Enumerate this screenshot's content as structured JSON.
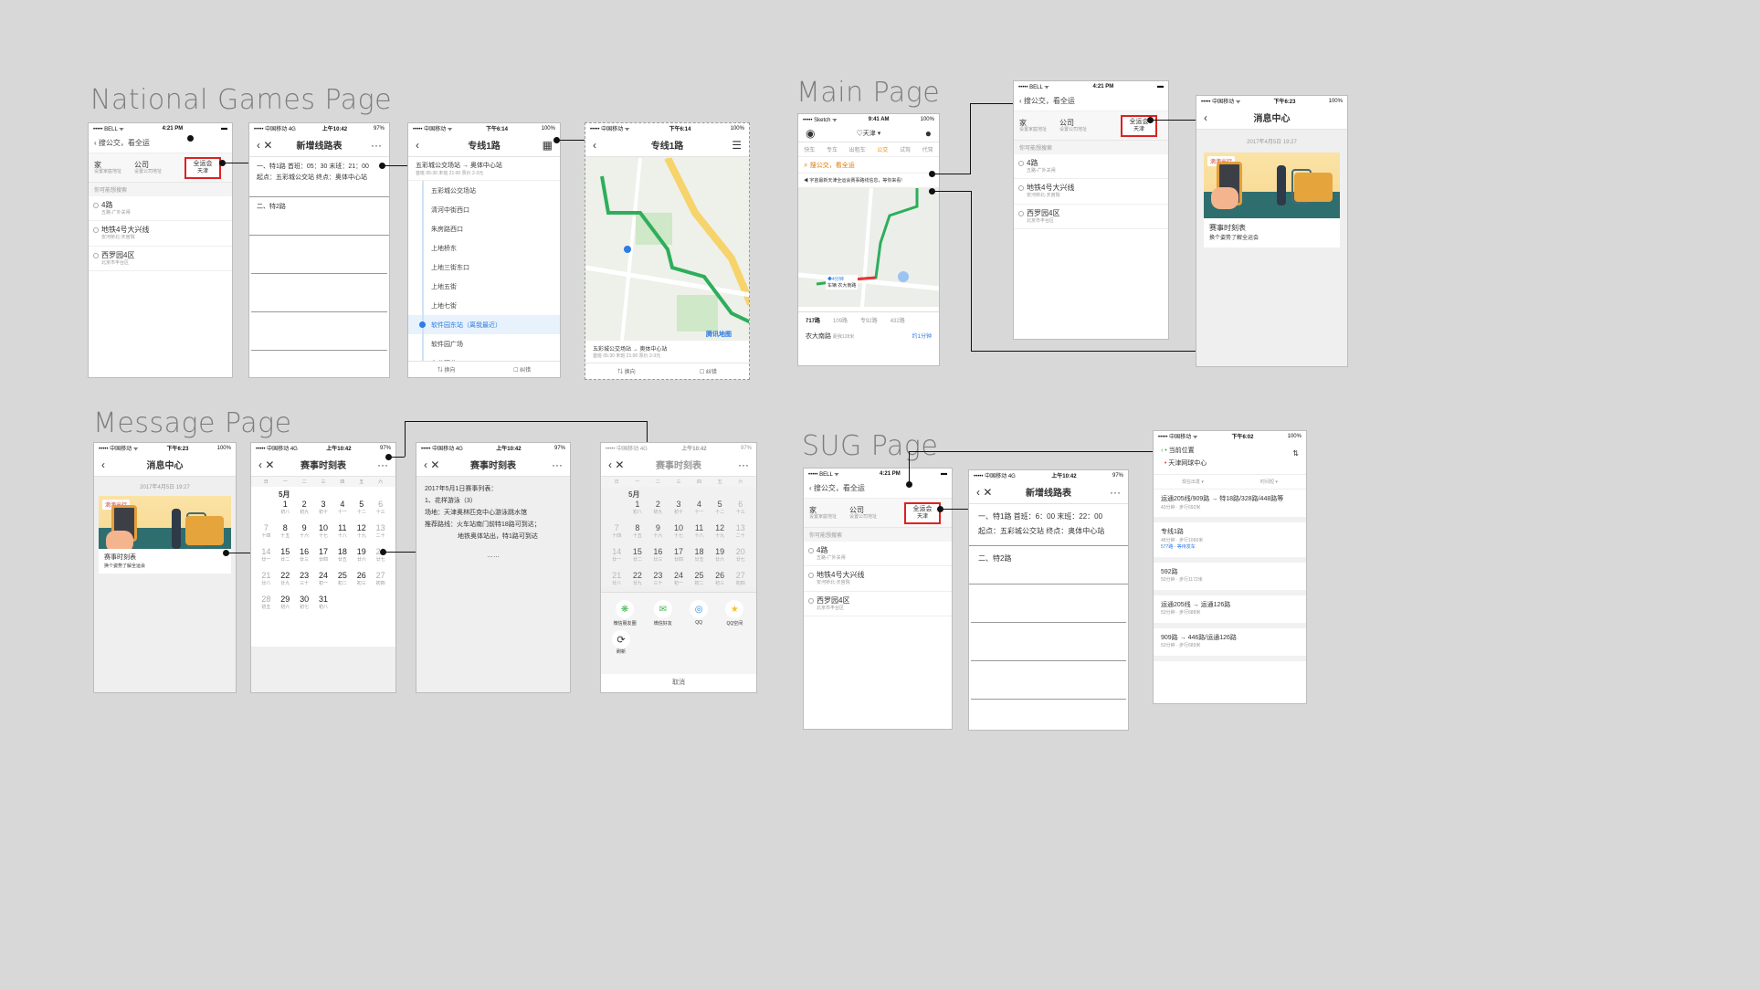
{
  "sections": {
    "national": "National Games Page",
    "main": "Main Page",
    "message": "Message Page",
    "sug": "SUG Page"
  },
  "status": {
    "bell": "••••• BELL ᯤ",
    "bell_time": "4:21 PM",
    "cm": "••••• 中国移动 4G",
    "cm_time": "上午10:42",
    "cm_batt": "97%",
    "cm2": "••••• 中国移动 ᯤ",
    "cm2_time": "下午6:14",
    "batt100": "100%",
    "msg_time": "下午6:23",
    "sketch": "••••• Sketch ᯤ",
    "sketch_time": "9:41 AM",
    "sug_time": "下午6:02"
  },
  "home": {
    "search": "搜公交，看全运",
    "home_label": "家",
    "home_sub": "设置家庭地址",
    "company_label": "公司",
    "company_sub": "设置公司地址",
    "games_label": "全运会",
    "games_sub": "天津",
    "history_label": "你可能想搜索",
    "items": [
      {
        "name": "4路",
        "sub": "五路-广外关闸"
      },
      {
        "name": "地铁4号大兴线",
        "sub": "安河桥北-天宫院"
      },
      {
        "name": "西罗园4区",
        "sub": "北京市丰台区"
      }
    ]
  },
  "newline": {
    "title": "新增线路表",
    "l1": "一、特1路 首班：05：30   末班：21：00",
    "l2": "起点：五彩城公交站 终点：奥体中心站",
    "l3": "二、特2路",
    "big1": "一、特1路 首班：6：00 末班：22：00",
    "big2": "起点：五彩城公交站 终点：奥体中心站",
    "big3": "二、特2路"
  },
  "route": {
    "title": "专线1路",
    "from_to": "五彩城公交场站 → 奥体中心站",
    "times": "首班 05:30  末班 21:00  票价 2-3元",
    "stops": [
      "五彩城公交场站",
      "清河中街西口",
      "朱房路西口",
      "上地桥东",
      "上地三街东口",
      "上地五街",
      "上地七街",
      "软件园东站（离我最近）",
      "软件园广场",
      "东北旺北"
    ],
    "swap": "⇅ 换向",
    "report": "☐ 纠错",
    "map_footer1": "五彩城公交场站 → 奥体中心站",
    "map_footer2": "首班 05:30  末班 21:00  票价 2-3元",
    "map_brand": "腾讯地图"
  },
  "main": {
    "city": "♡天津 ▾",
    "tabs": [
      "快车",
      "专车",
      "出租车",
      "公交",
      "试驾",
      "代驾"
    ],
    "search": "搜公交，看全运",
    "notice": "宇宙最新天津全运会赛事路线信息，等你来看!",
    "routes": [
      "717路",
      "109路",
      "专92路",
      "432路"
    ],
    "station": "农大南路",
    "station_sub": "距我128米",
    "eta": "约1分钟",
    "eta_label": "◆4分钟",
    "bus_label": "车辆 农大南路"
  },
  "msgcenter": {
    "title": "消息中心",
    "date": "2017年4月5日 19:27",
    "card_title": "赛事时刻表",
    "card_sub": "换个姿势了解全运会",
    "logo": "滴滴出行"
  },
  "calendar": {
    "title": "赛事时刻表",
    "weekdays": [
      "日",
      "一",
      "二",
      "三",
      "四",
      "五",
      "六"
    ],
    "month": "5月"
  },
  "schedule": {
    "title": "赛事时刻表",
    "l1": "2017年5月1日赛事列表：",
    "l2": "1、花样游泳（3）",
    "l3": "场地：天津奥林匹克中心游泳跳水馆",
    "l4": "推荐路线：火车站南门前特18路可到达；",
    "l5": "地铁奥体站出，特1路可到达",
    "more": "……"
  },
  "share": {
    "items": [
      "微信朋友圈",
      "微信好友",
      "QQ",
      "QQ空间"
    ],
    "refresh": "刷新",
    "cancel": "取消"
  },
  "sug": {
    "cur": "当前位置",
    "dest": "天津网球中心",
    "opt1": "现在出发 ▾",
    "opt2": "时间短 ▾",
    "results": [
      {
        "t": "运通205线/909路 → 特18路/328路/448路等",
        "s": "43分钟 · 步行692米"
      },
      {
        "t": "专线1路",
        "s": "48分钟 · 步行1066米",
        "a": "577路 · 等待发车"
      },
      {
        "t": "592路",
        "s": "50分钟 · 步行1172米"
      },
      {
        "t": "运通205线 → 运通126路",
        "s": "53分钟 · 步行688米"
      },
      {
        "t": "909路 → 446路/运通126路",
        "s": "53分钟 · 步行689米"
      }
    ]
  }
}
